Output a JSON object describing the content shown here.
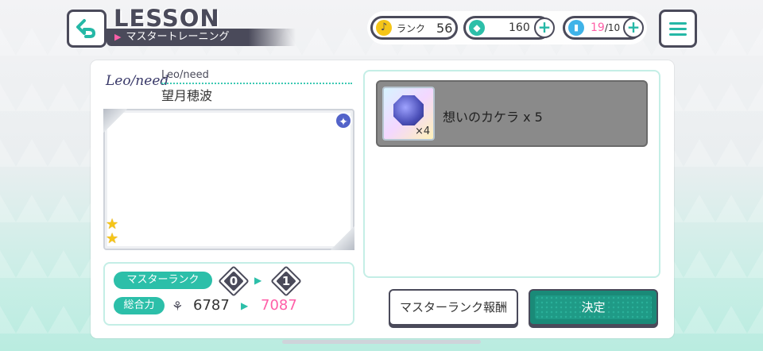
{
  "header": {
    "title": "LESSON",
    "subtitle": "マスタートレーニング",
    "rank_label": "ランク",
    "rank_value": "56",
    "crystals": "160",
    "boost_current": "19",
    "boost_max": "/10"
  },
  "character": {
    "unit_logo": "Leo/need",
    "unit_name": "Leo/need",
    "name": "望月穂波"
  },
  "stats": {
    "master_rank_label": "マスターランク",
    "rank_from": "0",
    "rank_to": "1",
    "power_label": "総合力",
    "power_old": "6787",
    "power_new": "7087"
  },
  "reward": {
    "item_name": "想いのカケラ x 5",
    "item_count": "×4"
  },
  "buttons": {
    "reward_label": "マスターランク報酬",
    "decide_label": "決定"
  },
  "colors": {
    "accent": "#2cbfa9",
    "dark": "#4a4a5a",
    "pink": "#ff5fa8"
  }
}
